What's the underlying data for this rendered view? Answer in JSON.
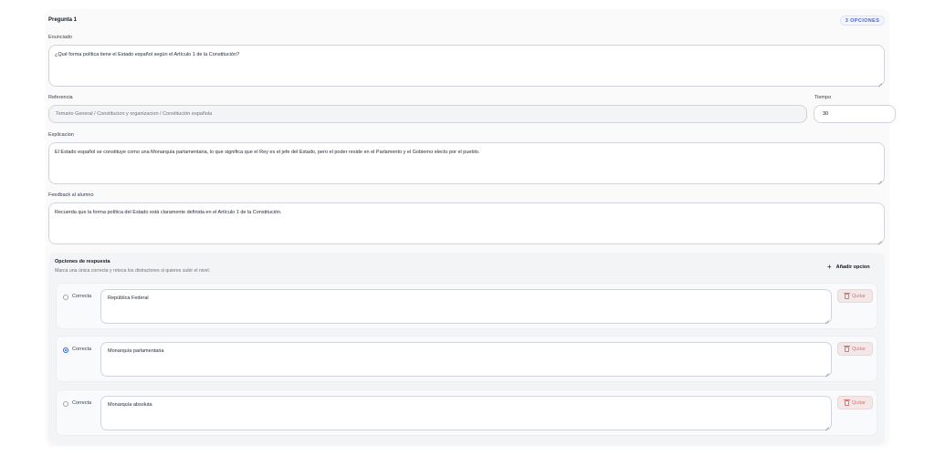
{
  "question": {
    "title": "Pregunta 1",
    "options_badge": "3 OPCIONES",
    "statement_label": "Enunciado",
    "statement_value": "¿Qué forma política tiene el Estado español según el Artículo 1 de la Constitución?",
    "reference_label": "Referencia",
    "reference_value": "Temario General / Constitucion y organizacion / Constitución española",
    "time_label": "Tiempo",
    "time_value": "30",
    "explanation_label": "Explicacion",
    "explanation_value": "El Estado español se constituye como una Monarquía parlamentaria, lo que significa que el Rey es el jefe del Estado, pero el poder reside en el Parlamento y el Gobierno electo por el pueblo.",
    "feedback_label": "Feedback al alumno",
    "feedback_value": "Recuerda que la forma política del Estado está claramente definida en el Artículo 1 de la Constitución."
  },
  "answers": {
    "title": "Opciones de respuesta",
    "subtitle": "Marca una única correcta y retoca los distractores si quieres subir el nivel.",
    "add_label": "Añadir opcion",
    "add_icon": "+",
    "options": [
      {
        "correct_label": "Correcta",
        "text": "República Federal",
        "remove_label": "Quitar",
        "selected": false
      },
      {
        "correct_label": "Correcta",
        "text": "Monarquía parlamentaria",
        "remove_label": "Quitar",
        "selected": true
      },
      {
        "correct_label": "Correcta",
        "text": "Monarquía absoluta",
        "remove_label": "Quitar",
        "selected": false
      }
    ]
  },
  "colors": {
    "accent": "#2563eb",
    "badge_text": "#4f5fd0",
    "danger": "#d97777"
  }
}
